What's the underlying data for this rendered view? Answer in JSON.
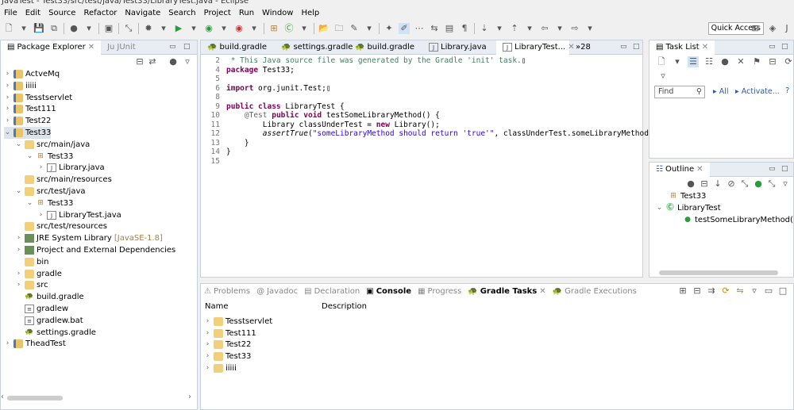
{
  "window": {
    "title": "JavaTest - Test33/src/test/java/Test33/LibraryTest.java - Eclipse"
  },
  "menu": [
    "File",
    "Edit",
    "Source",
    "Refactor",
    "Navigate",
    "Search",
    "Project",
    "Run",
    "Window",
    "Help"
  ],
  "toolbar": {
    "quick_access": "Quick Access"
  },
  "package_explorer": {
    "tabs": [
      "Package Explorer",
      "JUnit"
    ],
    "tree": [
      {
        "label": "ActveMq",
        "depth": 0,
        "arrow": "›",
        "icon": "project"
      },
      {
        "label": "iiiii",
        "depth": 0,
        "arrow": "›",
        "icon": "project"
      },
      {
        "label": "Tesstservlet",
        "depth": 0,
        "arrow": "›",
        "icon": "project"
      },
      {
        "label": "Test111",
        "depth": 0,
        "arrow": "›",
        "icon": "project"
      },
      {
        "label": "Test22",
        "depth": 0,
        "arrow": "›",
        "icon": "project"
      },
      {
        "label": "Test33",
        "depth": 0,
        "arrow": "⌄",
        "icon": "project",
        "selected": true
      },
      {
        "label": "src/main/java",
        "depth": 1,
        "arrow": "⌄",
        "icon": "source-folder"
      },
      {
        "label": "Test33",
        "depth": 2,
        "arrow": "⌄",
        "icon": "package"
      },
      {
        "label": "Library.java",
        "depth": 3,
        "arrow": "›",
        "icon": "java-file"
      },
      {
        "label": "src/main/resources",
        "depth": 1,
        "arrow": "",
        "icon": "source-folder"
      },
      {
        "label": "src/test/java",
        "depth": 1,
        "arrow": "⌄",
        "icon": "source-folder"
      },
      {
        "label": "Test33",
        "depth": 2,
        "arrow": "⌄",
        "icon": "package"
      },
      {
        "label": "LibraryTest.java",
        "depth": 3,
        "arrow": "›",
        "icon": "java-file"
      },
      {
        "label": "src/test/resources",
        "depth": 1,
        "arrow": "",
        "icon": "source-folder"
      },
      {
        "label": "JRE System Library",
        "suffix": "[JavaSE-1.8]",
        "depth": 1,
        "arrow": "›",
        "icon": "library"
      },
      {
        "label": "Project and External Dependencies",
        "depth": 1,
        "arrow": "›",
        "icon": "library"
      },
      {
        "label": "bin",
        "depth": 1,
        "arrow": "",
        "icon": "folder"
      },
      {
        "label": "gradle",
        "depth": 1,
        "arrow": "›",
        "icon": "folder"
      },
      {
        "label": "src",
        "depth": 1,
        "arrow": "›",
        "icon": "folder"
      },
      {
        "label": "build.gradle",
        "depth": 1,
        "arrow": "",
        "icon": "gradle"
      },
      {
        "label": "gradlew",
        "depth": 1,
        "arrow": "",
        "icon": "file"
      },
      {
        "label": "gradlew.bat",
        "depth": 1,
        "arrow": "",
        "icon": "file"
      },
      {
        "label": "settings.gradle",
        "depth": 1,
        "arrow": "",
        "icon": "gradle"
      },
      {
        "label": "TheadTest",
        "depth": 0,
        "arrow": "›",
        "icon": "project"
      }
    ]
  },
  "editor": {
    "tabs": [
      "build.gradle",
      "settings.gradle",
      "build.gradle",
      "Library.java",
      "LibraryTest..."
    ],
    "overflow": "»28",
    "lines": [
      {
        "n": "2",
        "html": "<span class='cm'> * This Java source file was generated by the Gradle 'init' task.</span>▯"
      },
      {
        "n": "4",
        "html": "<span class='kw'>package</span> Test33;"
      },
      {
        "n": "5",
        "html": ""
      },
      {
        "n": "6",
        "html": "<span class='kw'>import</span> org.junit.Test;▯"
      },
      {
        "n": "8",
        "html": ""
      },
      {
        "n": "9",
        "html": "<span class='kw'>public class</span> LibraryTest {"
      },
      {
        "n": "10",
        "html": "    <span class='an'>@Test</span> <span class='kw'>public void</span> testSomeLibraryMethod() {"
      },
      {
        "n": "11",
        "html": "        Library classUnderTest = <span class='kw'>new</span> Library();"
      },
      {
        "n": "12",
        "html": "        <span class='it'>assertTrue</span>(<span class='st'>\"someLibraryMethod should return 'true'\"</span>, classUnderTest.someLibraryMethod());"
      },
      {
        "n": "13",
        "html": "    }"
      },
      {
        "n": "14",
        "html": "}"
      },
      {
        "n": "15",
        "html": ""
      }
    ]
  },
  "task_list": {
    "title": "Task List",
    "find_placeholder": "Find",
    "all": "All",
    "activate": "Activate..."
  },
  "outline": {
    "title": "Outline",
    "items": [
      {
        "label": "Test33",
        "icon": "package"
      },
      {
        "label": "LibraryTest",
        "icon": "class"
      },
      {
        "label": "testSomeLibraryMethod() : v",
        "icon": "method"
      }
    ]
  },
  "bottom": {
    "tabs": [
      {
        "label": "Problems"
      },
      {
        "label": "Javadoc"
      },
      {
        "label": "Declaration"
      },
      {
        "label": "Console",
        "bold": true
      },
      {
        "label": "Progress"
      },
      {
        "label": "Gradle Tasks",
        "active": true
      },
      {
        "label": "Gradle Executions"
      }
    ],
    "columns": [
      "Name",
      "Description"
    ],
    "rows": [
      "Tesstservlet",
      "Test111",
      "Test22",
      "Test33",
      "iiiii"
    ]
  }
}
